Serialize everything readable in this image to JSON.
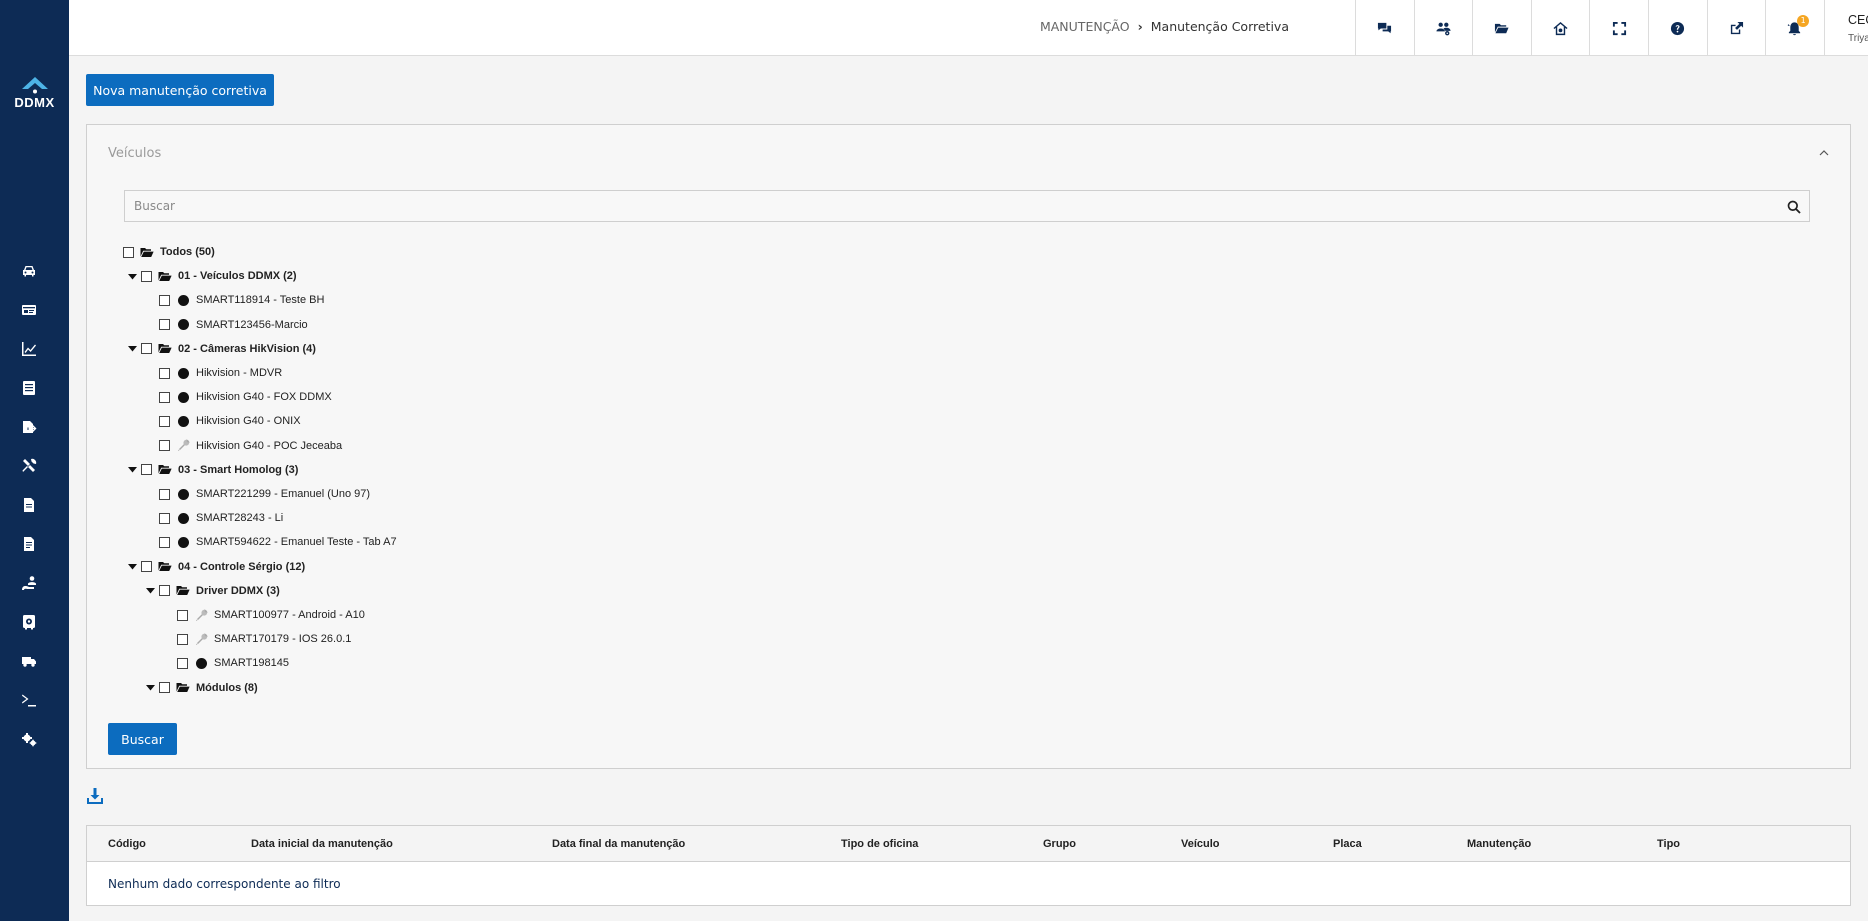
{
  "brand": {
    "logo_text": "DDMX"
  },
  "sidebar": {
    "icons": [
      "car-icon",
      "id-card-icon",
      "chart-line-icon",
      "list-icon",
      "file-export-icon",
      "tools-icon",
      "file-icon",
      "file-alt-icon",
      "user-road-icon",
      "safe-icon",
      "truck-icon",
      "terminal-icon",
      "cogs-icon"
    ]
  },
  "header": {
    "breadcrumb": {
      "section": "MANUTENÇÃO",
      "separator": "›",
      "page": "Manutenção Corretiva"
    },
    "icons": [
      "comments-icon",
      "users-cog-icon",
      "folder-icon",
      "home-gear-icon",
      "fullscreen-icon",
      "help-icon",
      "external-link-icon",
      "bell-icon"
    ],
    "notification_count": "1",
    "user": {
      "name": "CEO_DDMX",
      "subtitle": "Triyax native"
    }
  },
  "actions": {
    "new_button": "Nova manutenção corretiva"
  },
  "vehicles_panel": {
    "title": "Veículos",
    "search_placeholder": "Buscar",
    "tree": [
      {
        "level": 0,
        "type": "folder",
        "label": "Todos (50)",
        "expanded": null
      },
      {
        "level": 1,
        "type": "folder",
        "label": "01 - Veículos DDMX (2)",
        "expanded": true
      },
      {
        "level": 2,
        "type": "vehicle",
        "icon": "dot",
        "label": "SMART118914 - Teste BH"
      },
      {
        "level": 2,
        "type": "vehicle",
        "icon": "dot",
        "label": "SMART123456-Marcio"
      },
      {
        "level": 1,
        "type": "folder",
        "label": "02 - Câmeras HikVision (4)",
        "expanded": true
      },
      {
        "level": 2,
        "type": "vehicle",
        "icon": "dot",
        "label": "Hikvision - MDVR"
      },
      {
        "level": 2,
        "type": "vehicle",
        "icon": "dot",
        "label": "Hikvision G40 - FOX DDMX"
      },
      {
        "level": 2,
        "type": "vehicle",
        "icon": "dot",
        "label": "Hikvision G40 - ONIX"
      },
      {
        "level": 2,
        "type": "vehicle",
        "icon": "wrench",
        "label": "Hikvision G40 - POC Jeceaba"
      },
      {
        "level": 1,
        "type": "folder",
        "label": "03 - Smart Homolog (3)",
        "expanded": true
      },
      {
        "level": 2,
        "type": "vehicle",
        "icon": "dot",
        "label": "SMART221299 - Emanuel (Uno 97)"
      },
      {
        "level": 2,
        "type": "vehicle",
        "icon": "dot",
        "label": "SMART28243 - Li"
      },
      {
        "level": 2,
        "type": "vehicle",
        "icon": "dot",
        "label": "SMART594622 - Emanuel Teste - Tab A7"
      },
      {
        "level": 1,
        "type": "folder",
        "label": "04 - Controle Sérgio (12)",
        "expanded": true
      },
      {
        "level": 2,
        "type": "folder",
        "label": "Driver DDMX (3)",
        "expanded": true
      },
      {
        "level": 3,
        "type": "vehicle",
        "icon": "wrench",
        "label": "SMART100977 - Android - A10"
      },
      {
        "level": 3,
        "type": "vehicle",
        "icon": "wrench",
        "label": "SMART170179 - IOS 26.0.1"
      },
      {
        "level": 3,
        "type": "vehicle",
        "icon": "dot",
        "label": "SMART198145"
      },
      {
        "level": 2,
        "type": "folder",
        "label": "Módulos (8)",
        "expanded": true
      }
    ],
    "search_button": "Buscar"
  },
  "table": {
    "columns": [
      "Código",
      "Data inicial da manutenção",
      "Data final da manutenção",
      "Tipo de oficina",
      "Grupo",
      "Veículo",
      "Placa",
      "Manutenção",
      "Tipo"
    ],
    "empty_message": "Nenhum dado correspondente ao filtro"
  },
  "colors": {
    "sidebar": "#0d2b55",
    "primary": "#0c6cbf",
    "badge": "#f5a623"
  }
}
